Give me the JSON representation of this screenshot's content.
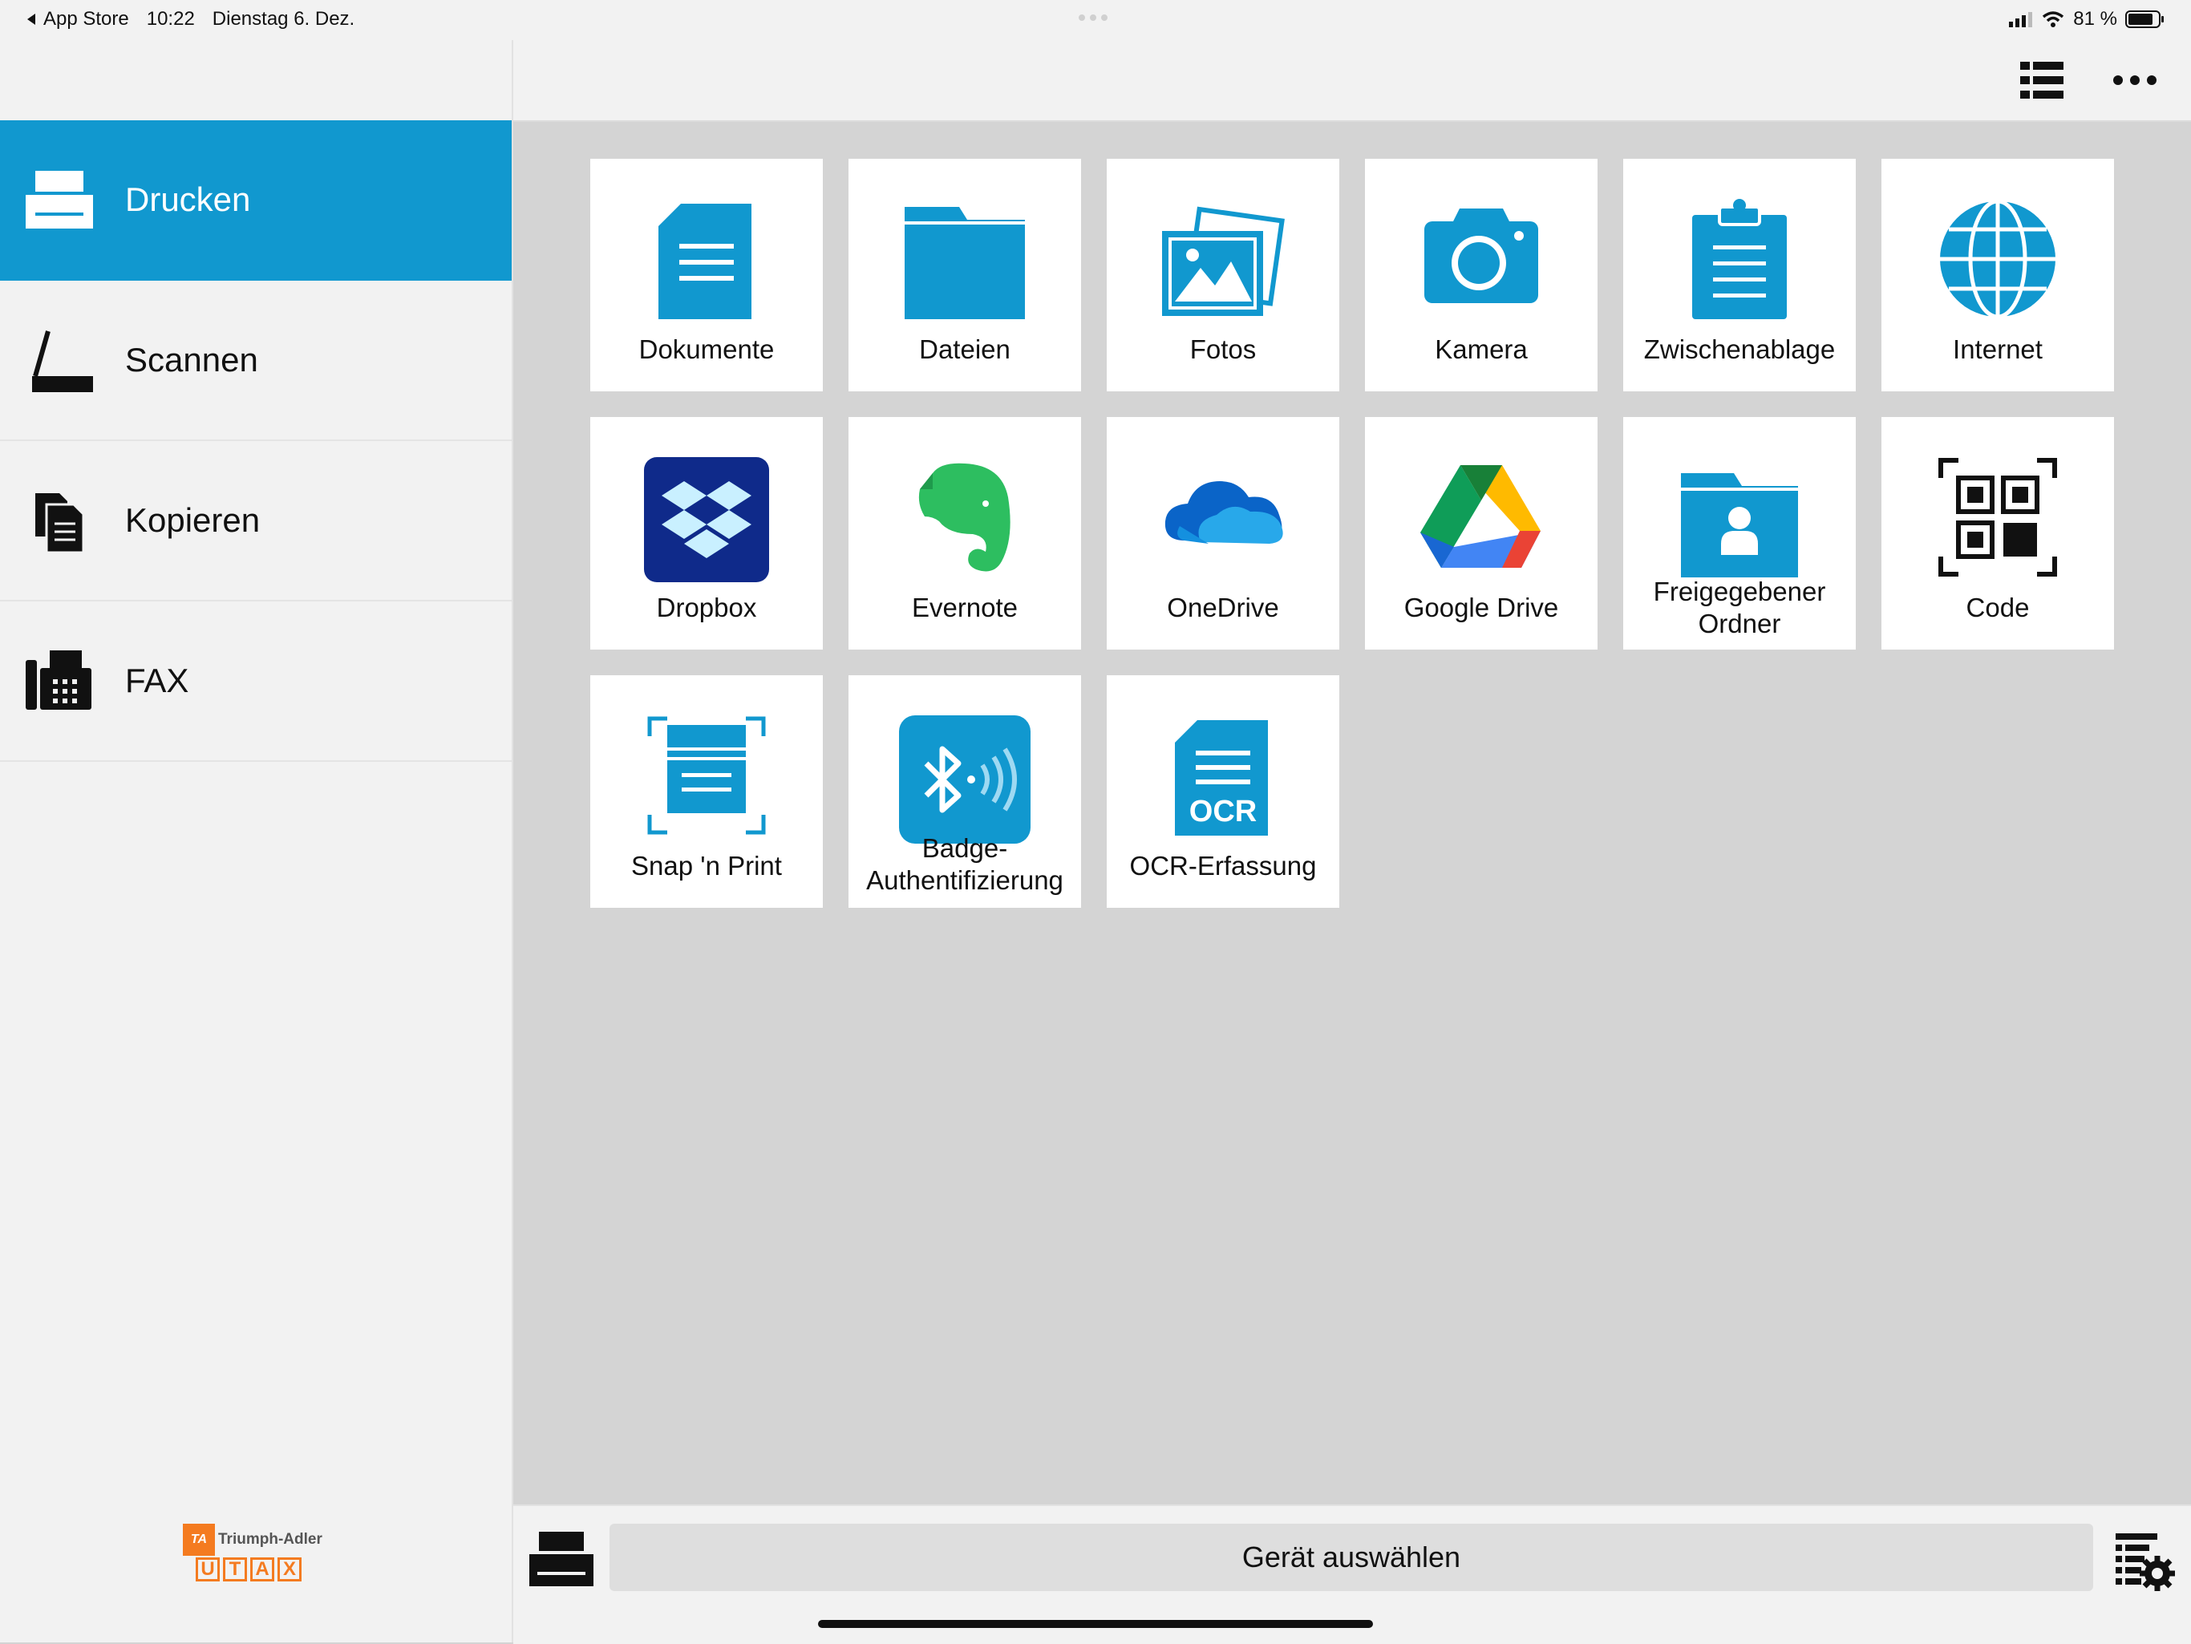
{
  "status_bar": {
    "back_label": "App Store",
    "time": "10:22",
    "date": "Dienstag 6. Dez.",
    "battery": "81 %"
  },
  "sidebar": {
    "items": [
      {
        "label": "Drucken",
        "icon": "printer-icon",
        "active": true
      },
      {
        "label": "Scannen",
        "icon": "scanner-icon",
        "active": false
      },
      {
        "label": "Kopieren",
        "icon": "copy-icon",
        "active": false
      },
      {
        "label": "FAX",
        "icon": "fax-icon",
        "active": false
      }
    ],
    "brand": {
      "ta_badge": "TA",
      "ta_name": "Triumph-Adler",
      "utax": [
        "U",
        "T",
        "A",
        "X"
      ]
    }
  },
  "topbar": {
    "icons": [
      "list-view-icon",
      "more-icon"
    ]
  },
  "tiles": [
    {
      "label": "Dokumente",
      "icon": "document-icon"
    },
    {
      "label": "Dateien",
      "icon": "folder-icon"
    },
    {
      "label": "Fotos",
      "icon": "photos-icon"
    },
    {
      "label": "Kamera",
      "icon": "camera-icon"
    },
    {
      "label": "Zwischenablage",
      "icon": "clipboard-icon"
    },
    {
      "label": "Internet",
      "icon": "globe-icon"
    },
    {
      "label": "Dropbox",
      "icon": "dropbox-icon"
    },
    {
      "label": "Evernote",
      "icon": "evernote-icon"
    },
    {
      "label": "OneDrive",
      "icon": "onedrive-icon"
    },
    {
      "label": "Google Drive",
      "icon": "google-drive-icon"
    },
    {
      "label_line1": "Freigegebener",
      "label_line2": "Ordner",
      "icon": "shared-folder-icon"
    },
    {
      "label": "Code",
      "icon": "qr-code-icon"
    },
    {
      "label": "Snap 'n Print",
      "icon": "snap-print-icon"
    },
    {
      "label_line1": "Badge-",
      "label_line2": "Authentifizierung",
      "icon": "bluetooth-badge-icon"
    },
    {
      "label": "OCR-Erfassung",
      "icon": "ocr-icon",
      "ocr_text": "OCR"
    }
  ],
  "bottom_bar": {
    "device_button": "Gerät auswählen"
  },
  "colors": {
    "accent": "#1198cf",
    "brand_orange": "#f47b20",
    "dropbox": "#0f2a8a",
    "evernote": "#2dbe60"
  }
}
